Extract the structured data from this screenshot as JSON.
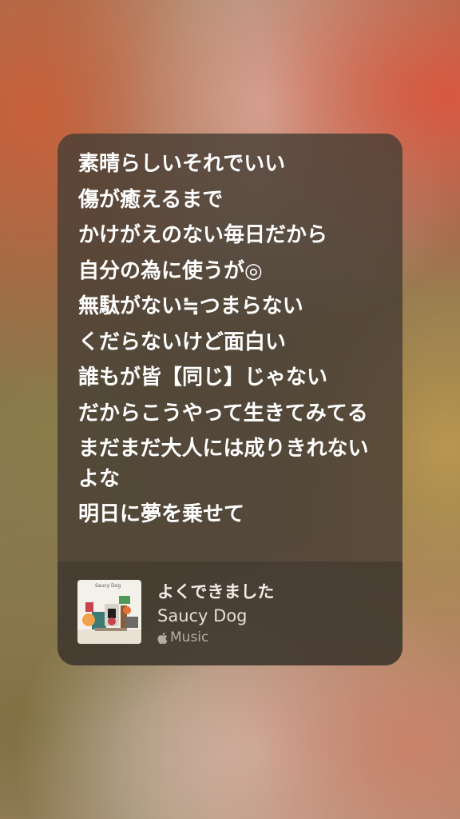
{
  "lyrics": [
    "素晴らしいそれでいい",
    "傷が癒えるまで",
    "かけがえのない毎日だから",
    "自分の為に使うが◎",
    "無駄がない≒つまらない",
    "くだらないけど面白い",
    "誰もが皆【同じ】じゃない",
    "だからこうやって生きてみてる",
    "まだまだ大人には成りきれないよな",
    "明日に夢を乗せて"
  ],
  "track": {
    "title": "よくできました",
    "artist": "Saucy Dog",
    "service": "Music",
    "artwork_label": "Saucy Dog",
    "artwork_icon": "album-artwork"
  },
  "icons": {
    "service_icon": "apple-icon"
  },
  "colors": {
    "lyric_text": "#ffffff",
    "card_background": "#483e34"
  }
}
